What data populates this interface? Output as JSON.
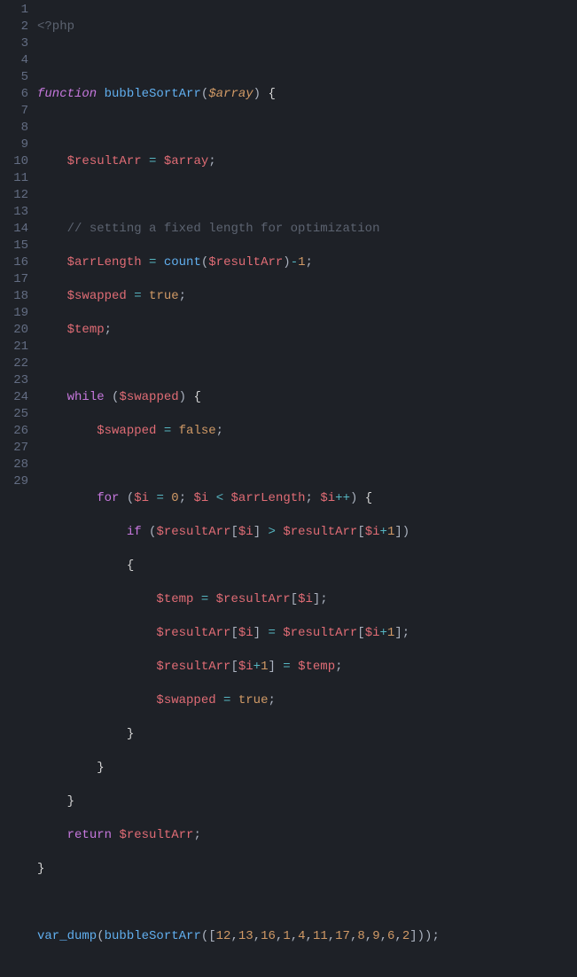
{
  "lines": {
    "n1": "1",
    "n2": "2",
    "n3": "3",
    "n4": "4",
    "n5": "5",
    "n6": "6",
    "n7": "7",
    "n8": "8",
    "n9": "9",
    "n10": "10",
    "n11": "11",
    "n12": "12",
    "n13": "13",
    "n14": "14",
    "n15": "15",
    "n16": "16",
    "n17": "17",
    "n18": "18",
    "n19": "19",
    "n20": "20",
    "n21": "21",
    "n22": "22",
    "n23": "23",
    "n24": "24",
    "n25": "25",
    "n26": "26",
    "n27": "27",
    "n28": "28",
    "n29": "29"
  },
  "t": {
    "php_open": "<?php",
    "function": "function",
    "bubbleSortArr": "bubbleSortArr",
    "array_param": "$array",
    "resultArr": "$resultArr",
    "array_var": "$array",
    "comment_opt": "// setting a fixed length for optimization",
    "arrLength": "$arrLength",
    "count": "count",
    "swapped": "$swapped",
    "temp": "$temp",
    "true": "true",
    "false": "false",
    "while": "while",
    "for": "for",
    "if": "if",
    "i": "$i",
    "return": "return",
    "var_dump": "var_dump",
    "eq": "=",
    "semi": ";",
    "lp": "(",
    "rp": ")",
    "lb": "{",
    "rb": "}",
    "lsq": "[",
    "rsq": "]",
    "lt": "<",
    "gt": ">",
    "plus": "+",
    "pp": "++",
    "minus": "-",
    "comma": ",",
    "n0": "0",
    "n1": "1",
    "a12": "12",
    "a13": "13",
    "a16": "16",
    "a1": "1",
    "a4": "4",
    "a11": "11",
    "a17": "17",
    "a8": "8",
    "a9": "9",
    "a6": "6",
    "a2": "2"
  }
}
